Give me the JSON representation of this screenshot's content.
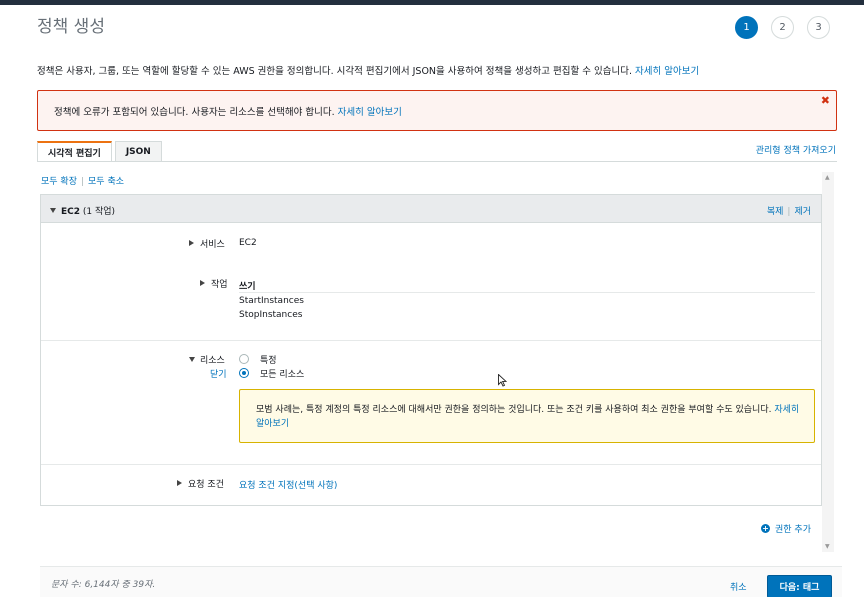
{
  "page": {
    "title": "정책 생성",
    "steps": [
      "1",
      "2",
      "3"
    ],
    "intro_text": "정책은 사용자, 그룹, 또는 역할에 할당할 수 있는 AWS 권한을 정의합니다. 시각적 편집기에서 JSON을 사용하여 정책을 생성하고 편집할 수 있습니다. ",
    "intro_link": "자세히 알아보기"
  },
  "error": {
    "text": "정책에 오류가 포함되어 있습니다. 사용자는 리소스를 선택해야 합니다. ",
    "link": "자세히 알아보기",
    "close_glyph": "✖"
  },
  "tabs": [
    {
      "label": "시각적 편집기",
      "active": true
    },
    {
      "label": "JSON",
      "active": false
    }
  ],
  "import_link": "관리형 정책 가져오기",
  "expand_all": "모두 확장",
  "collapse_all": "모두 축소",
  "separator": "|",
  "panel": {
    "title": "EC2",
    "title_suffix": "(1 작업)",
    "duplicate": "복제",
    "remove": "제거",
    "service_label": "서비스",
    "service_value": "EC2",
    "actions_label": "작업",
    "actions_group": "쓰기",
    "actions_items": [
      "StartInstances",
      "StopInstances"
    ],
    "resources_label": "리소스",
    "resources_close": "닫기",
    "resource_options": [
      {
        "label": "특정",
        "checked": false
      },
      {
        "label": "모든 리소스",
        "checked": true
      }
    ],
    "info_text": "모범 사례는, 특정 계정의 특정 리소스에 대해서만 권한을 정의하는 것입니다. 또는 조건 키를 사용하여 최소 권한을 부여할 수도 있습니다. ",
    "info_link": "자세히 알아보기",
    "conditions_label": "요청 조건",
    "conditions_link": "요청 조건 지정(선택 사항)"
  },
  "add_permission": "권한 추가",
  "footer": {
    "char_count": "문자 수: 6,144자 중 39자.",
    "cancel": "취소",
    "next": "다음: 태그"
  },
  "colors": {
    "accent": "#0073bb",
    "error": "#d13212",
    "warning_border": "#d7b300",
    "tab_active": "#ec7211"
  }
}
